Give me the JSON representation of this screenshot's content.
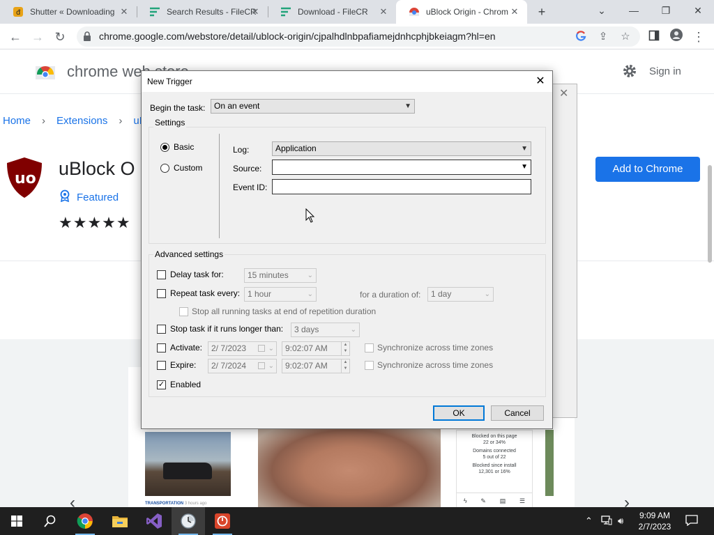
{
  "browser": {
    "tabs": [
      {
        "title": "Shutter « Downloading",
        "icon": "blogger-favicon"
      },
      {
        "title": "Search Results - FileCR",
        "icon": "filecr-favicon"
      },
      {
        "title": "Download - FileCR",
        "icon": "filecr-favicon"
      },
      {
        "title": "uBlock Origin - Chrom",
        "icon": "chrome-webstore-favicon",
        "active": true
      }
    ],
    "url": "chrome.google.com/webstore/detail/ublock-origin/cjpalhdlnbpafiamejdnhcphjbkeiagm?hl=en"
  },
  "store": {
    "name": "chrome web store",
    "signin": "Sign in",
    "breadcrumb": [
      "Home",
      "Extensions",
      "uBl"
    ],
    "extension_name": "uBlock O",
    "featured": "Featured",
    "rating_stars": 5,
    "add_button": "Add to Chrome",
    "gallery": {
      "caption": "TRANSPORTATION",
      "caption_time": "3 hours ago",
      "panel_lines": [
        "Blocked on this page",
        "22 or 34%",
        "Domains connected",
        "5 out of 22",
        "Blocked since install",
        "12,301 or 16%"
      ]
    }
  },
  "dialog": {
    "title": "New Trigger",
    "begin_label": "Begin the task:",
    "begin_value": "On an event",
    "settings_label": "Settings",
    "radio_basic": "Basic",
    "radio_custom": "Custom",
    "log_label": "Log:",
    "log_value": "Application",
    "source_label": "Source:",
    "source_value": "",
    "eventid_label": "Event ID:",
    "eventid_value": "",
    "advanced_label": "Advanced settings",
    "delay_label": "Delay task for:",
    "delay_value": "15 minutes",
    "repeat_label": "Repeat task every:",
    "repeat_value": "1 hour",
    "duration_label": "for a duration of:",
    "duration_value": "1 day",
    "stop_all_label": "Stop all running tasks at end of repetition duration",
    "stop_longer_label": "Stop task if it runs longer than:",
    "stop_longer_value": "3 days",
    "activate_label": "Activate:",
    "activate_date": "2/  7/2023",
    "activate_time": "9:02:07 AM",
    "expire_label": "Expire:",
    "expire_date": "2/  7/2024",
    "expire_time": "9:02:07 AM",
    "sync_label": "Synchronize across time zones",
    "enabled_label": "Enabled",
    "enabled_checked": true,
    "ok": "OK",
    "cancel": "Cancel"
  },
  "taskbar": {
    "time": "9:09 AM",
    "date": "2/7/2023"
  },
  "colors": {
    "accent": "#1a73e8",
    "ublock_red": "#800000",
    "win_focus": "#0078d7"
  }
}
